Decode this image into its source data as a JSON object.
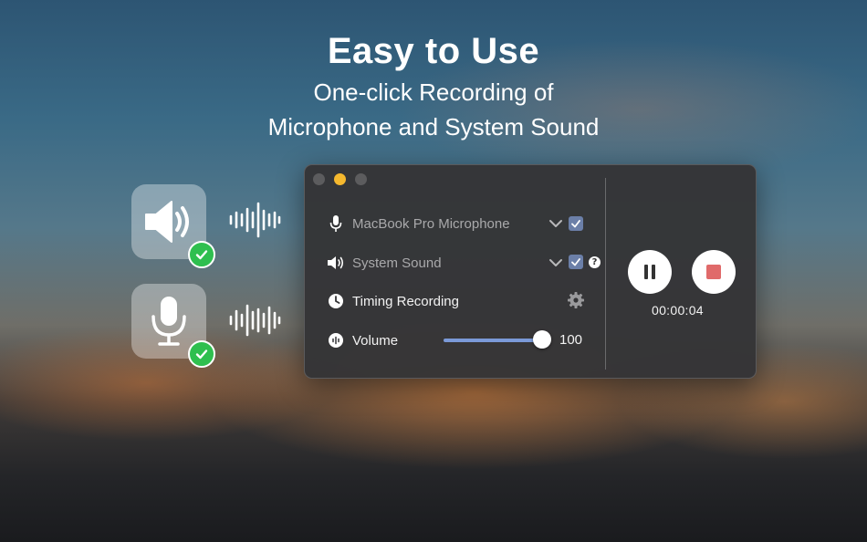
{
  "hero": {
    "title": "Easy to Use",
    "line1": "One-click Recording of",
    "line2": "Microphone and System Sound"
  },
  "side_icons": [
    {
      "icon": "speaker-icon",
      "checked": true
    },
    {
      "icon": "microphone-icon",
      "checked": true
    }
  ],
  "window": {
    "sources": [
      {
        "label": "MacBook Pro Microphone",
        "icon": "microphone-icon",
        "checked": true
      },
      {
        "label": "System Sound",
        "icon": "speaker-icon",
        "checked": true,
        "help": "?"
      }
    ],
    "timing": {
      "label": "Timing Recording",
      "icon": "clock-icon"
    },
    "volume": {
      "label": "Volume",
      "value": "100",
      "level": 1.0
    },
    "timer": "00:00:04"
  },
  "colors": {
    "accent": "#7b9ad8",
    "checkbox": "#6b7fa8",
    "minimize": "#f5b82e",
    "stop": "#e06a6a",
    "badge": "#2fbf4f"
  }
}
